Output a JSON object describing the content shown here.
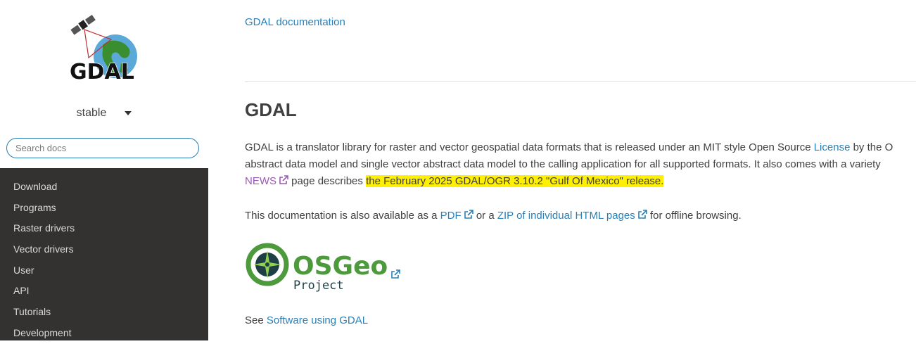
{
  "sidebar": {
    "logo_text": "GDAL",
    "version": "stable",
    "search_placeholder": "Search docs",
    "nav": [
      "Download",
      "Programs",
      "Raster drivers",
      "Vector drivers",
      "User",
      "API",
      "Tutorials",
      "Development"
    ]
  },
  "main": {
    "breadcrumb": "GDAL documentation",
    "title": "GDAL",
    "p1": {
      "line1_text": "GDAL is a translator library for raster and vector geospatial data formats that is released under an MIT style Open Source ",
      "line1_link": "License",
      "line1_tail": " by the O",
      "line2": "abstract data model and single vector abstract data model to the calling application for all supported formats. It also comes with a variety",
      "line3_link": "NEWS",
      "line3_text": " page describes ",
      "line3_highlight": "the February 2025 GDAL/OGR 3.10.2 \"Gulf Of Mexico\" release."
    },
    "p2": {
      "pre": "This documentation is also available as a ",
      "pdf": "PDF",
      "mid": " or a ",
      "zip": "ZIP of individual HTML pages",
      "post": " for offline browsing."
    },
    "osgeo": {
      "name": "OSGeo",
      "sub": "Project"
    },
    "p3": {
      "pre": "See ",
      "link": "Software using GDAL"
    }
  },
  "colors": {
    "link": "#2980b9",
    "visited": "#9b59b6",
    "sidebar_bg": "#343131",
    "highlight": "#ffef00",
    "osgeo_green": "#4c9a3c"
  }
}
